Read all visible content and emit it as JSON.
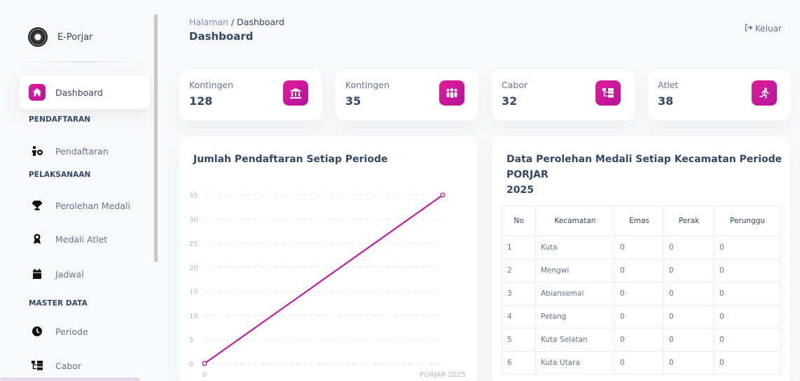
{
  "brand": {
    "name": "E-Porjar",
    "logo_icon": "emblem-icon"
  },
  "sidebar": {
    "dashboard": {
      "label": "Dashboard",
      "icon": "home-icon"
    },
    "sections": {
      "pendaftaran": "PENDAFTARAN",
      "pelaksanaan": "PELAKSANAAN",
      "master_data": "MASTER DATA"
    },
    "items": {
      "pendaftaran": {
        "label": "Pendaftaran",
        "icon": "user-plus-icon"
      },
      "perolehan_medali": {
        "label": "Perolehan Medali",
        "icon": "trophy-icon"
      },
      "medali_atlet": {
        "label": "Medali Atlet",
        "icon": "medal-icon"
      },
      "jadwal": {
        "label": "Jadwal",
        "icon": "calendar-icon"
      },
      "periode": {
        "label": "Periode",
        "icon": "clock-icon"
      },
      "cabor": {
        "label": "Cabor",
        "icon": "sitemap-icon"
      }
    }
  },
  "header": {
    "breadcrumb_root": "Halaman",
    "breadcrumb_sep": "/",
    "breadcrumb_current": "Dashboard",
    "title": "Dashboard",
    "logout_label": "Keluar"
  },
  "stats": [
    {
      "label": "Kontingen",
      "value": "128",
      "icon": "landmark-icon"
    },
    {
      "label": "Kontingen",
      "value": "35",
      "icon": "users-icon"
    },
    {
      "label": "Cabor",
      "value": "32",
      "icon": "sitemap-icon"
    },
    {
      "label": "Atlet",
      "value": "38",
      "icon": "running-icon"
    }
  ],
  "chart_card": {
    "title": "Jumlah Pendaftaran Setiap Periode"
  },
  "chart_data": {
    "type": "line",
    "title": "Jumlah Pendaftaran Setiap Periode",
    "x": [
      "0",
      "PORJAR 2025"
    ],
    "y": [
      0,
      35
    ],
    "ylim": [
      0,
      35
    ],
    "yticks": [
      0,
      5,
      10,
      15,
      20,
      25,
      30,
      35
    ],
    "xlabel": "",
    "ylabel": "",
    "grid": true,
    "color": "#c21aa6"
  },
  "table_card": {
    "title_line1": "Data Perolehan Medali Setiap Kecamatan Periode PORJAR",
    "title_line2": "2025",
    "columns": [
      "No",
      "Kecamatan",
      "Emas",
      "Perak",
      "Perunggu"
    ],
    "rows": [
      [
        "1",
        "Kuta",
        "0",
        "0",
        "0"
      ],
      [
        "2",
        "Mengwi",
        "0",
        "0",
        "0"
      ],
      [
        "3",
        "Abiansemal",
        "0",
        "0",
        "0"
      ],
      [
        "4",
        "Petang",
        "0",
        "0",
        "0"
      ],
      [
        "5",
        "Kuta Selatan",
        "0",
        "0",
        "0"
      ],
      [
        "6",
        "Kuta Utara",
        "0",
        "0",
        "0"
      ]
    ]
  },
  "colors": {
    "accent": "#c21aa6",
    "accent_gradient_start": "#e31c9a",
    "text": "#344767",
    "muted": "#67748e"
  }
}
